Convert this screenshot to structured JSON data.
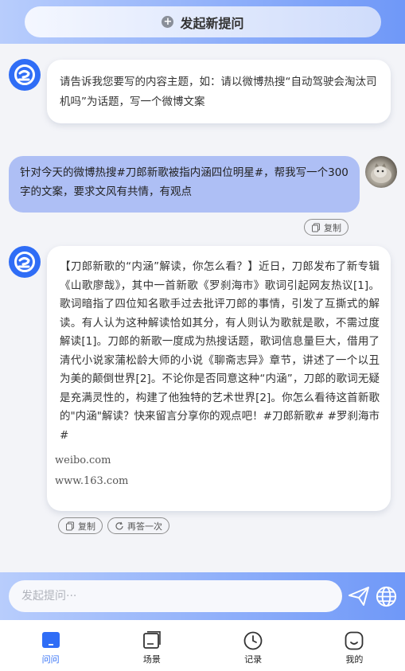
{
  "header": {
    "new_question_label": "发起新提问"
  },
  "messages": {
    "bot_intro": "请告诉我您要写的内容主题，如：请以微博热搜“自动驾驶会淘汰司机吗”为话题，写一个微博文案",
    "user_prompt": "针对今天的微博热搜#刀郎新歌被指内涵四位明星#，帮我写一个300字的文案，要求文风有共情，有观点",
    "user_copy_label": "复制",
    "bot_answer": "【刀郎新歌的“内涵”解读，你怎么看？】近日，刀郎发布了新专辑《山歌廖哉》，其中一首新歌《罗刹海市》歌词引起网友热议[1]。歌词暗指了四位知名歌手过去批评刀郎的事情，引发了互撕式的解读。有人认为这种解读恰如其分，有人则认为歌就是歌，不需过度解读[1]。刀郎的新歌一度成为热搜话题，歌词信息量巨大，借用了清代小说家蒲松龄大师的小说《聊斋志异》章节，讲述了一个以丑为美的颠倒世界[2]。不论你是否同意这种“内涵”，刀郎的歌词无疑是充满灵性的，构建了他独特的艺术世界[2]。你怎么看待这首新歌的\"内涵\"解读？快来留言分享你的观点吧！#刀郎新歌# #罗刹海市#",
    "sources": [
      "weibo.com",
      "www.163.com"
    ],
    "copy_label": "复制",
    "regenerate_label": "再答一次"
  },
  "input": {
    "placeholder": "发起提问···"
  },
  "nav": {
    "items": [
      {
        "label": "问问",
        "active": true
      },
      {
        "label": "场景"
      },
      {
        "label": "记录"
      },
      {
        "label": "我的"
      }
    ]
  },
  "colors": {
    "accent": "#2f6df6",
    "user_bubble": "#aebff5"
  }
}
